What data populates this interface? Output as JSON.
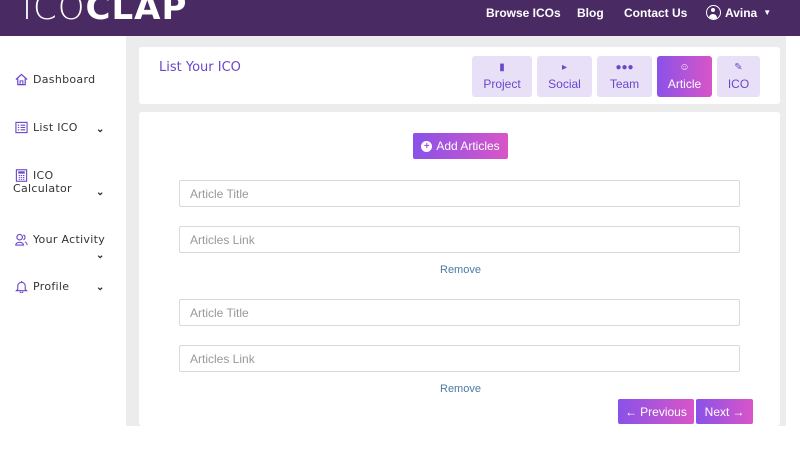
{
  "brand": {
    "logo_light": "ICO",
    "logo_bold": "CLAP"
  },
  "nav": {
    "browse": "Browse ICOs",
    "blog": "Blog",
    "contact": "Contact Us",
    "user": "Avina"
  },
  "sidebar": {
    "items": [
      {
        "label": "Dashboard",
        "icon": "home-icon"
      },
      {
        "label": "List ICO",
        "icon": "list-icon"
      },
      {
        "label": "ICO Calculator",
        "line1": "ICO",
        "line2": "Calculator",
        "icon": "calculator-icon"
      },
      {
        "label": "Your Activity",
        "icon": "users-icon"
      },
      {
        "label": "Profile",
        "icon": "bell-icon"
      }
    ]
  },
  "header": {
    "title": "List Your ICO",
    "tabs": [
      {
        "label": "Project",
        "icon": "file-icon"
      },
      {
        "label": "Social",
        "icon": "megaphone-icon"
      },
      {
        "label": "Team",
        "icon": "group-icon"
      },
      {
        "label": "Article",
        "icon": "smile-icon",
        "active": true
      },
      {
        "label": "ICO",
        "icon": "edit-icon"
      }
    ]
  },
  "content": {
    "add_label": "Add Articles",
    "articles": [
      {
        "title_placeholder": "Article Title",
        "link_placeholder": "Articles Link",
        "remove_label": "Remove"
      },
      {
        "title_placeholder": "Article Title",
        "link_placeholder": "Articles Link",
        "remove_label": "Remove"
      }
    ],
    "previous_label": "Previous",
    "next_label": "Next"
  },
  "colors": {
    "topbar": "#4a2a63",
    "accent_start": "#8a52e8",
    "accent_end": "#d855c8",
    "title": "#6b47c9"
  }
}
